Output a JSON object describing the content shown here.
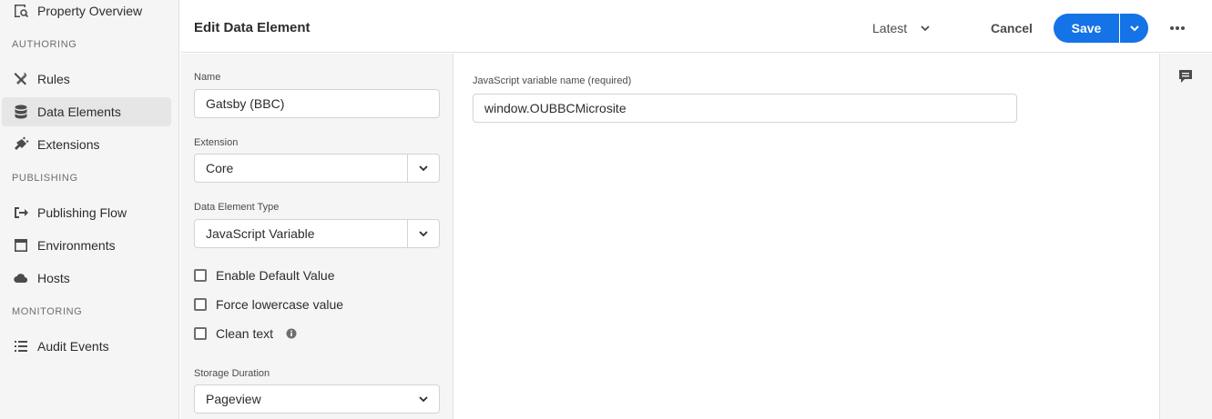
{
  "sidebar": {
    "top_item": "Property Overview",
    "authoring_label": "AUTHORING",
    "authoring_items": [
      "Rules",
      "Data Elements",
      "Extensions"
    ],
    "publishing_label": "PUBLISHING",
    "publishing_items": [
      "Publishing Flow",
      "Environments",
      "Hosts"
    ],
    "monitoring_label": "MONITORING",
    "monitoring_items": [
      "Audit Events"
    ],
    "selected": "Data Elements"
  },
  "header": {
    "title": "Edit Data Element",
    "version": "Latest",
    "cancel_label": "Cancel",
    "save_label": "Save"
  },
  "form": {
    "name_label": "Name",
    "name_value": "Gatsby (BBC)",
    "extension_label": "Extension",
    "extension_value": "Core",
    "type_label": "Data Element Type",
    "type_value": "JavaScript Variable",
    "checkboxes": [
      "Enable Default Value",
      "Force lowercase value",
      "Clean text"
    ],
    "storage_label": "Storage Duration",
    "storage_value": "Pageview"
  },
  "main": {
    "js_var_label": "JavaScript variable name (required)",
    "js_var_value": "window.OUBBCMicrosite"
  },
  "colors": {
    "accent": "#1473e6",
    "sidebar_bg": "#f5f5f5",
    "selected_bg": "#e6e6e6"
  }
}
